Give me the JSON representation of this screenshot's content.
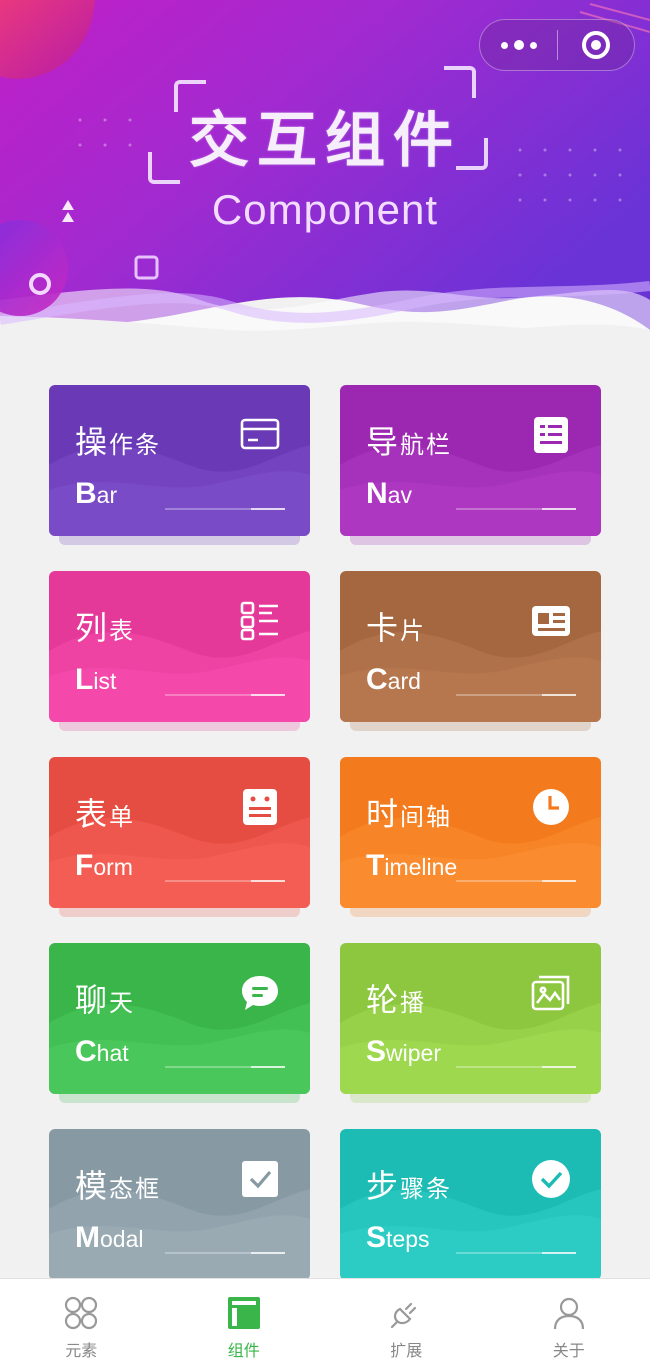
{
  "header": {
    "title": "交互组件",
    "subtitle": "Component",
    "capsule": {
      "more_icon": "more-dots-icon",
      "close_icon": "target-close-icon"
    }
  },
  "cards": [
    {
      "zh_first": "操",
      "zh_rest": "作条",
      "en_cap": "B",
      "en_rest": "ar",
      "color": "#6a3ab6",
      "icon": "bar-icon"
    },
    {
      "zh_first": "导",
      "zh_rest": "航栏",
      "en_cap": "N",
      "en_rest": "av",
      "color": "#9c27b0",
      "icon": "nav-icon"
    },
    {
      "zh_first": "列",
      "zh_rest": "表",
      "en_cap": "L",
      "en_rest": "ist",
      "color": "#e53999",
      "icon": "list-icon"
    },
    {
      "zh_first": "卡",
      "zh_rest": "片",
      "en_cap": "C",
      "en_rest": "ard",
      "color": "#a5673f",
      "icon": "card-icon"
    },
    {
      "zh_first": "表",
      "zh_rest": "单",
      "en_cap": "F",
      "en_rest": "orm",
      "color": "#e54d42",
      "icon": "form-icon"
    },
    {
      "zh_first": "时",
      "zh_rest": "间轴",
      "en_cap": "T",
      "en_rest": "imeline",
      "color": "#f37b1d",
      "icon": "clock-icon"
    },
    {
      "zh_first": "聊",
      "zh_rest": "天",
      "en_cap": "C",
      "en_rest": "hat",
      "color": "#39b54a",
      "icon": "chat-icon"
    },
    {
      "zh_first": "轮",
      "zh_rest": "播",
      "en_cap": "S",
      "en_rest": "wiper",
      "color": "#8dc63f",
      "icon": "image-icon"
    },
    {
      "zh_first": "模",
      "zh_rest": "态框",
      "en_cap": "M",
      "en_rest": "odal",
      "color": "#8799a3",
      "icon": "check-square-icon"
    },
    {
      "zh_first": "步",
      "zh_rest": "骤条",
      "en_cap": "S",
      "en_rest": "teps",
      "color": "#1cbbb4",
      "icon": "check-circle-icon"
    }
  ],
  "tabbar": {
    "items": [
      {
        "label": "元素",
        "icon": "elements-icon",
        "active": false
      },
      {
        "label": "组件",
        "icon": "component-icon",
        "active": true
      },
      {
        "label": "扩展",
        "icon": "plugin-icon",
        "active": false
      },
      {
        "label": "关于",
        "icon": "user-icon",
        "active": false
      }
    ],
    "active_color": "#39b54a",
    "inactive_color": "#888888"
  }
}
